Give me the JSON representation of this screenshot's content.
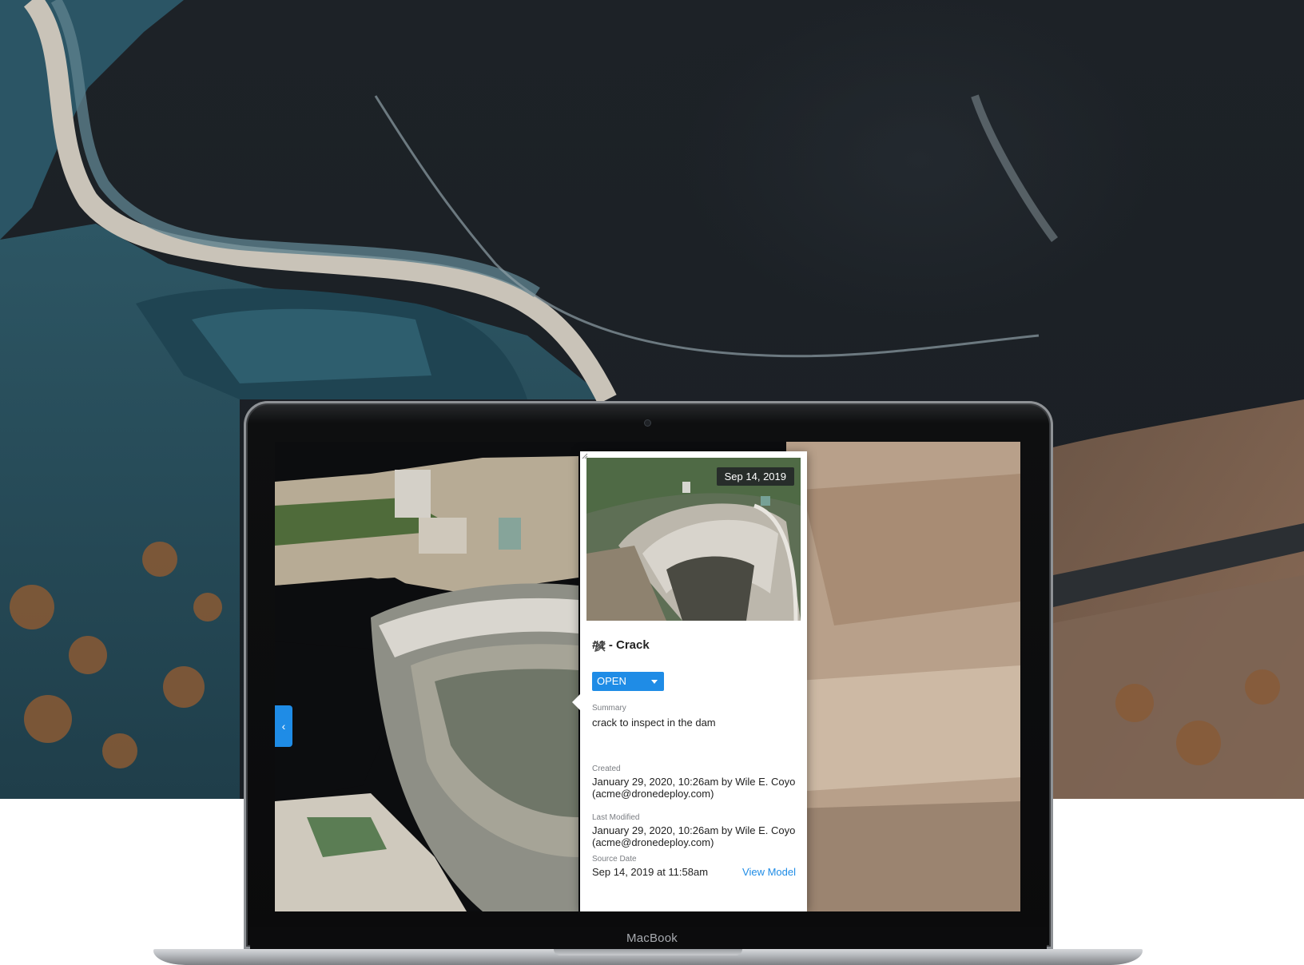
{
  "laptop": {
    "brand": "MacBook"
  },
  "issue": {
    "photo_date": "Sep 14, 2019",
    "title": "#1 - Crack",
    "status": "OPEN",
    "summary_label": "Summary",
    "summary": "crack to inspect in the dam",
    "created_label": "Created",
    "created_value": "January 29, 2020, 10:26am by Wile E. Coyo (acme@dronedeploy.com)",
    "modified_label": "Last Modified",
    "modified_value": "January 29, 2020, 10:26am by Wile E. Coyo (acme@dronedeploy.com)",
    "source_date_label": "Source Date",
    "source_date_value": "Sep 14, 2019 at 11:58am",
    "view_model_link": "View Model"
  },
  "icons": {
    "edit": "pencil-icon",
    "close": "close-icon",
    "status_caret": "caret-down-icon",
    "panel_toggle": "chevron-left-icon"
  },
  "colors": {
    "accent": "#1f8ce6",
    "water": "#1b2026",
    "teal_tint": "#2e6c80"
  }
}
